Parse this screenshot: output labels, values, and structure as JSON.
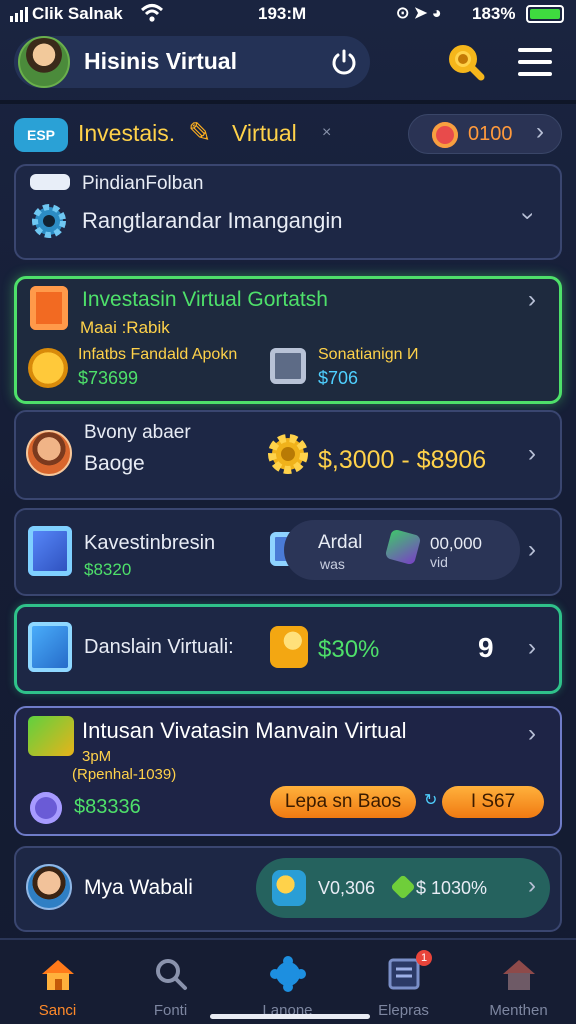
{
  "status_bar": {
    "carrier": "Clik Salnak",
    "time": "193:M",
    "battery_pct": "183%",
    "battery_level": 1.0
  },
  "header": {
    "title": "Hisinis Virtual",
    "icons": [
      "avatar",
      "power-icon",
      "search-icon",
      "menu-icon"
    ]
  },
  "section": {
    "badge": "ESP",
    "title_left": "Investais.",
    "title_right": "Virtual",
    "close": "×",
    "coins": "0100"
  },
  "dropdown": {
    "label": "PindianFolban",
    "value": "Rangtlarandar Imangangin"
  },
  "card_investasi": {
    "title": "Investasin Virtual Gortatsh",
    "subtitle": "Maai :Rabik",
    "left_label": "Infatbs Fandald Apokn",
    "left_value": "$73699",
    "right_label": "Sonatianign И",
    "right_value": "$706"
  },
  "card_range": {
    "line1": "Bvony abaer",
    "line2": "Baoge",
    "range": "$,3000 - $8906"
  },
  "card_kaves": {
    "title": "Kavestinbresin",
    "value": "$8320",
    "pill_label": "Ardal",
    "pill_sub": "was",
    "pill_value": "00,000",
    "pill_value_sub": "vid"
  },
  "card_danslain": {
    "title": "Danslain Virtuali:",
    "percent": "$30%",
    "count": "9"
  },
  "card_intusan": {
    "title": "Intusan Vivatasin Manvain Virtual",
    "sub1": "3pM",
    "sub2": "(Rpenhal-1039)",
    "value": "$83336",
    "button1": "Lepa sn Baos",
    "button2": "I S67"
  },
  "card_mya": {
    "name": "Mya Wabali",
    "pill_value1": "V0,306",
    "pill_value2": "$ 1030%"
  },
  "nav": [
    {
      "label": "Sanci",
      "icon": "home-icon",
      "active": true
    },
    {
      "label": "Fonti",
      "icon": "search-icon",
      "active": false
    },
    {
      "label": "Lanone",
      "icon": "puzzle-icon",
      "active": false
    },
    {
      "label": "Elepras",
      "icon": "document-icon",
      "active": false,
      "badge": "1"
    },
    {
      "label": "Menthen",
      "icon": "house-icon",
      "active": false
    }
  ],
  "colors": {
    "accent_gold": "#ffd24a",
    "accent_green": "#4ee06a",
    "accent_orange": "#f49a2b",
    "background": "#17203a"
  }
}
